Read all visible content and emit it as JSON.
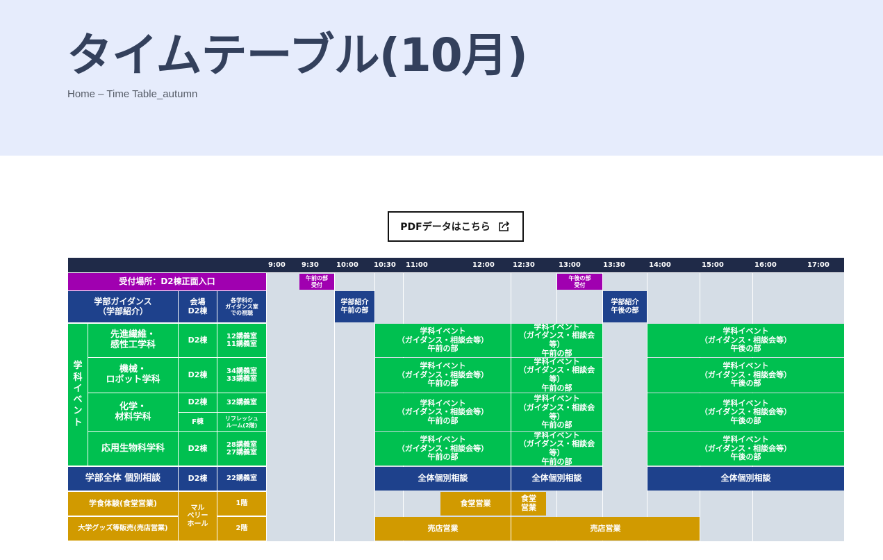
{
  "page": {
    "title": "タイムテーブル(10月)",
    "breadcrumb": "Home – Time Table_autumn"
  },
  "pdf_button": {
    "label": "PDFデータはこちら",
    "icon": "share-icon"
  },
  "timetable": {
    "times": [
      "9:00",
      "9:30",
      "10:00",
      "10:30",
      "11:00",
      "12:00",
      "12:30",
      "13:00",
      "13:30",
      "14:00",
      "15:00",
      "16:00",
      "17:00"
    ],
    "reception": {
      "label": "受付場所：D2棟正面入口",
      "morning": "午前の部\n受付",
      "afternoon": "午後の部\n受付"
    },
    "guidance": {
      "label": "学部ガイダンス\n（学部紹介）",
      "venue": "会場\nD2棟",
      "room": "各学科の\nガイダンス室\nでの視聴",
      "morning": "学部紹介\n午前の部",
      "afternoon": "学部紹介\n午後の部"
    },
    "dept_group_label": "学\n科\nイ\nベ\nン\nト",
    "event_am": "学科イベント\n（ガイダンス・相談会等）\n午前の部",
    "event_pm": "学科イベント\n（ガイダンス・相談会等）\n午後の部",
    "departments": [
      {
        "name": "先進繊維・\n感性工学科",
        "building": "D2棟",
        "room": "12講義室\n11講義室"
      },
      {
        "name": "機械・\nロボット学科",
        "building": "D2棟",
        "room": "34講義室\n33講義室"
      },
      {
        "name": "化学・\n材料学科",
        "building": "D2棟",
        "room": "32講義室",
        "building2": "F棟",
        "room2": "リフレッシュ\nルーム(2階)"
      },
      {
        "name": "応用生物科学科",
        "building": "D2棟",
        "room": "28講義室\n27講義室"
      }
    ],
    "consultation": {
      "label": "学部全体 個別相談",
      "building": "D2棟",
      "room": "22講義室",
      "block": "全体個別相談"
    },
    "cafeteria": {
      "label": "学食体験(食堂営業)",
      "venue": "マル\nベリー\nホール",
      "floor": "1階",
      "block1": "食堂営業",
      "block2": "食堂\n営業"
    },
    "goods": {
      "label": "大学グッズ等販売(売店営業)",
      "floor": "2階",
      "block": "売店営業"
    },
    "colors": {
      "header": "#1f2a48",
      "navy": "#1e418c",
      "green": "#00c050",
      "purple": "#a000b0",
      "gold": "#d19a00",
      "empty": "#d5dde6"
    }
  }
}
